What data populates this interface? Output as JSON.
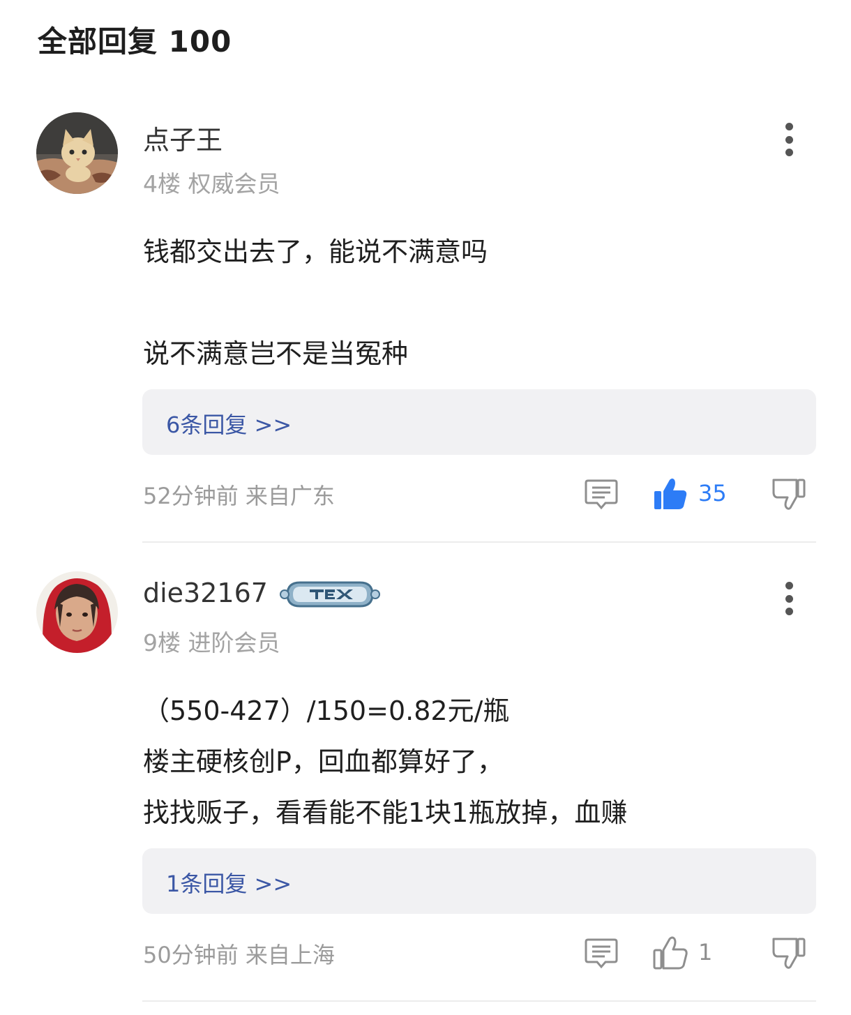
{
  "header": {
    "title": "全部回复 100"
  },
  "comments": [
    {
      "username": "点子王",
      "floor": "4楼",
      "member_level": "权威会员",
      "avatar_icon": "cat-avatar",
      "body": [
        "钱都交出去了，能说不满意吗",
        "说不满意岂不是当冤种"
      ],
      "replies_label": "6条回复 >>",
      "time_location": "52分钟前 来自广东",
      "likes": "35",
      "liked": true,
      "accent_color": "#2d7cf6"
    },
    {
      "username": "die32167",
      "floor": "9楼",
      "member_level": "进阶会员",
      "avatar_icon": "person-avatar",
      "badge_icon": "member-badge-icon",
      "body": [
        "（550-427）/150=0.82元/瓶",
        "楼主硬核创P，回血都算好了，",
        "找找贩子，看看能不能1块1瓶放掉，血赚"
      ],
      "replies_label": "1条回复 >>",
      "time_location": "50分钟前 来自上海",
      "likes": "1",
      "liked": false
    }
  ]
}
